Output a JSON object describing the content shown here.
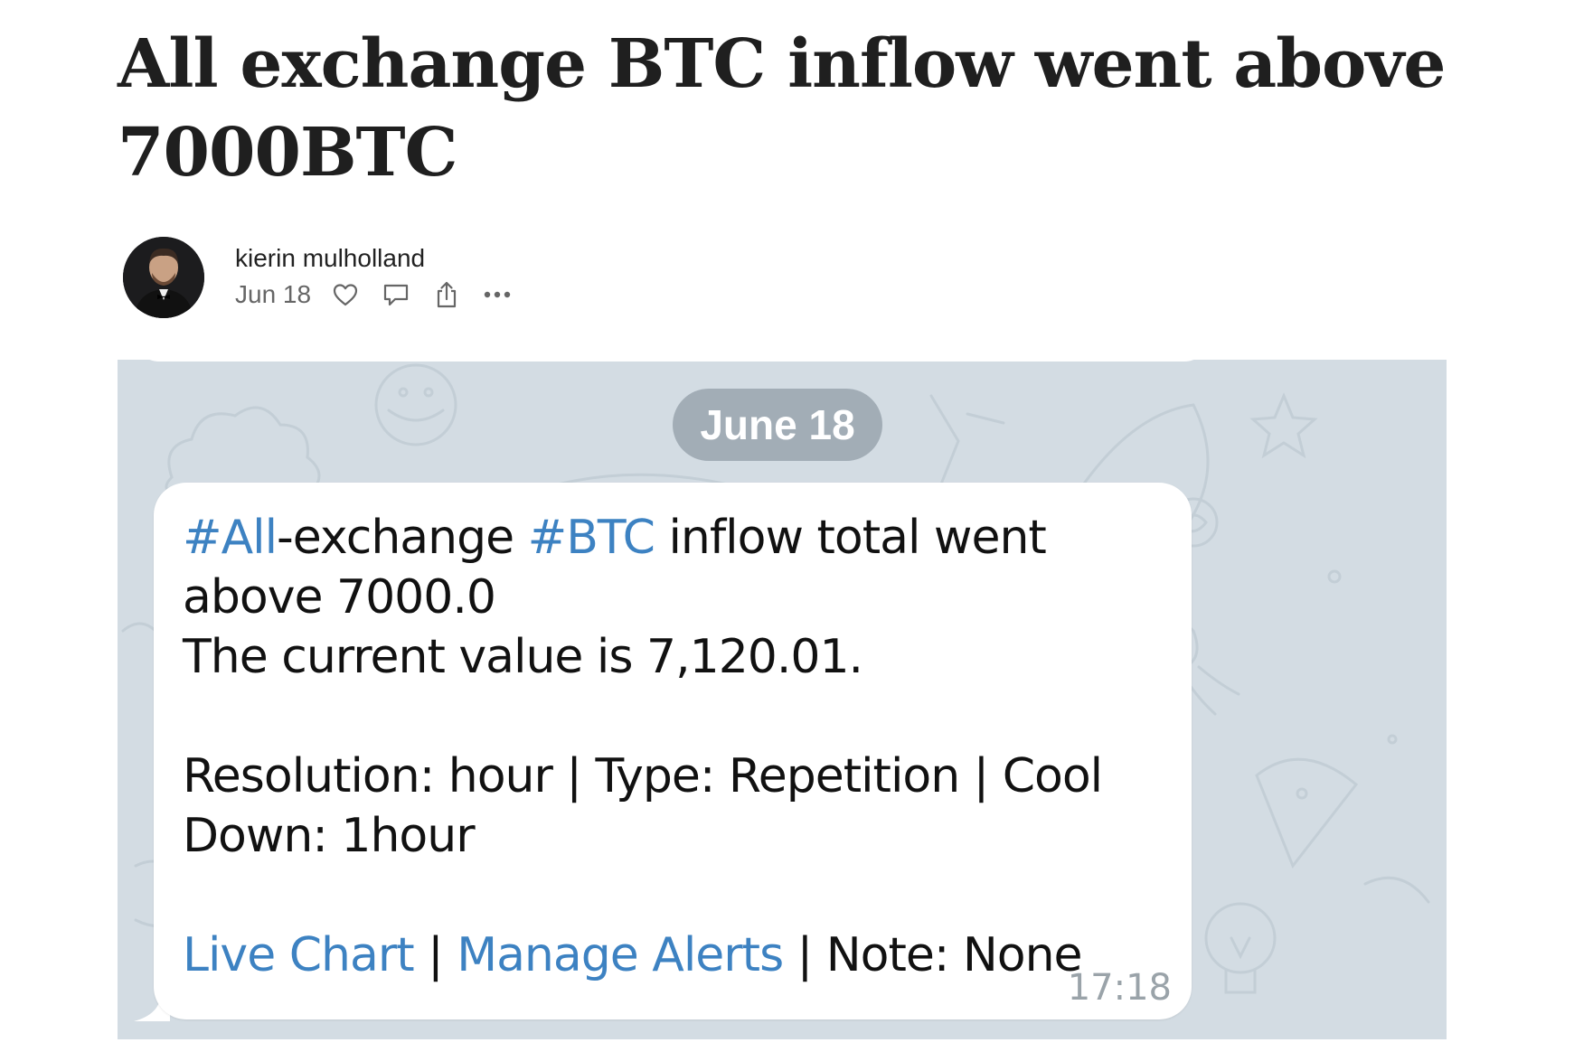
{
  "article": {
    "title": "All exchange BTC inflow went above 7000BTC",
    "author": "kierin mulholland",
    "date": "Jun 18"
  },
  "icons": {
    "like": "heart-icon",
    "comment": "comment-icon",
    "share": "share-icon",
    "more": "more-icon"
  },
  "chat": {
    "date_separator": "June 18",
    "message": {
      "tag_all": "#All",
      "text_exchange": "-exchange ",
      "tag_btc": "#BTC",
      "text_inflow": " inflow total went above 7000.0",
      "text_current": "The current value is 7,120.01.",
      "text_settings": "Resolution: hour | Type: Repetition | Cool Down: 1hour",
      "link_live_chart": "Live Chart",
      "separator_1": " | ",
      "link_manage_alerts": "Manage Alerts",
      "separator_2": " | ",
      "note": "Note: None",
      "time": "17:18"
    }
  },
  "colors": {
    "link": "#3d82c2",
    "chat_background": "#d3dce3",
    "date_pill": "#a2adb6",
    "bubble": "#ffffff",
    "time": "#9aa3a9"
  }
}
